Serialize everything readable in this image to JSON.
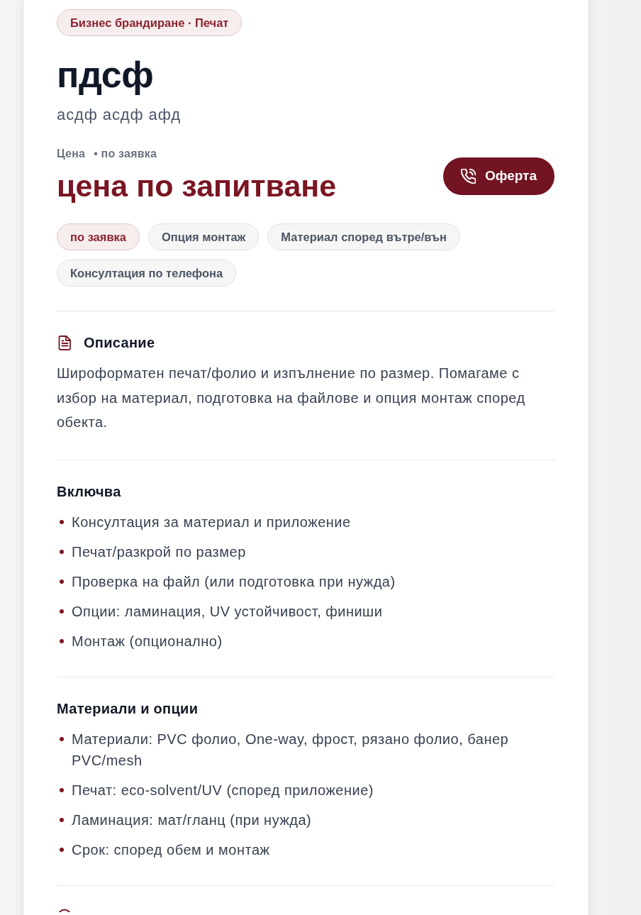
{
  "category_badge": "Бизнес брандиране · Печат",
  "title": "пдсф",
  "subtitle": "асдф асдф афд",
  "price": {
    "label": "Цена",
    "note": "• по заявка",
    "value": "цена по запитване"
  },
  "offer_button": {
    "label": "Оферта"
  },
  "tags": [
    {
      "label": "по заявка",
      "kind": "accent"
    },
    {
      "label": "Опция монтаж",
      "kind": "plain"
    },
    {
      "label": "Материал според вътре/вън",
      "kind": "plain"
    },
    {
      "label": "Консултация по телефона",
      "kind": "plain"
    }
  ],
  "sections": [
    {
      "kind": "description",
      "title": "Описание",
      "text": "Широформатен печат/фолио и изпълнение по размер. Помагаме с избор на материал, подготовка на файлове и опция монтаж според обекта."
    },
    {
      "kind": "list",
      "title": "Включва",
      "items": [
        "Консултация за материал и приложение",
        "Печат/разкрой по размер",
        "Проверка на файл (или подготовка при нужда)",
        "Опции: ламинация, UV устойчивост, финиши",
        "Монтаж (опционално)"
      ]
    },
    {
      "kind": "list",
      "title": "Материали и опции",
      "items": [
        "Материали: PVC фолио, One-way, фрост, рязано фолио, банер PVC/mesh",
        "Печат: eco-solvent/UV (според приложение)",
        "Ламинация: мат/гланц (при нужда)",
        "Срок: според обем и монтаж"
      ]
    },
    {
      "kind": "cut"
    }
  ]
}
